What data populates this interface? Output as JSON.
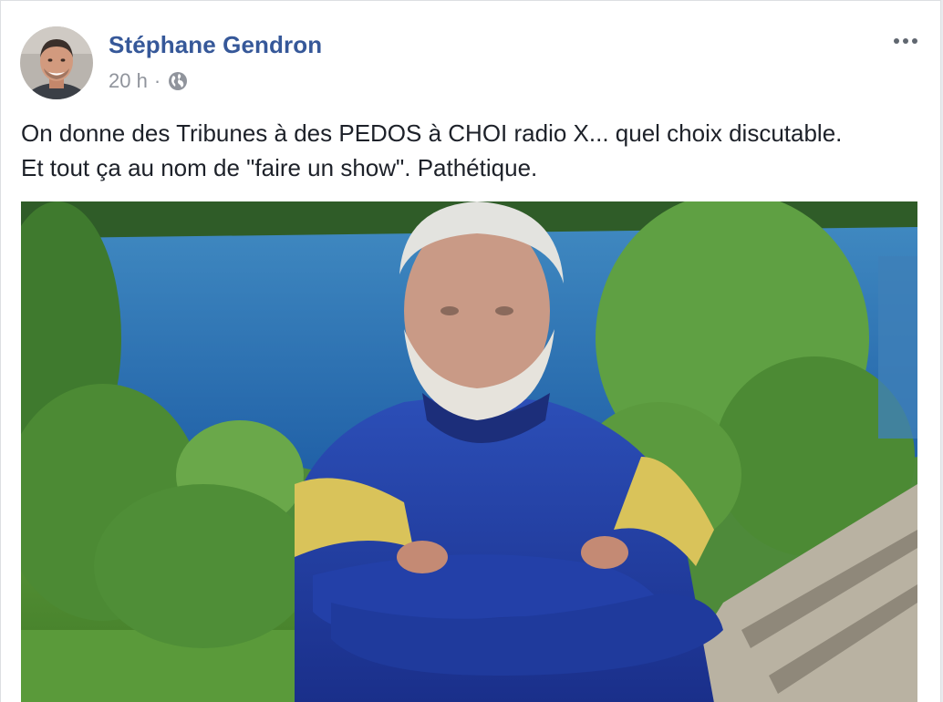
{
  "post": {
    "author": "Stéphane Gendron",
    "time": "20 h",
    "separator": "·",
    "privacy_icon": "globe-icon",
    "options_icon": "more-options-icon",
    "text": "On donne des Tribunes à des PEDOS à CHOI radio X... quel choix discutable. Et tout ça au nom de \"faire un show\". Pathétique.",
    "media": "video-frame"
  },
  "colors": {
    "author_link": "#365899",
    "meta_gray": "#90949c",
    "body_text": "#1d2129"
  }
}
